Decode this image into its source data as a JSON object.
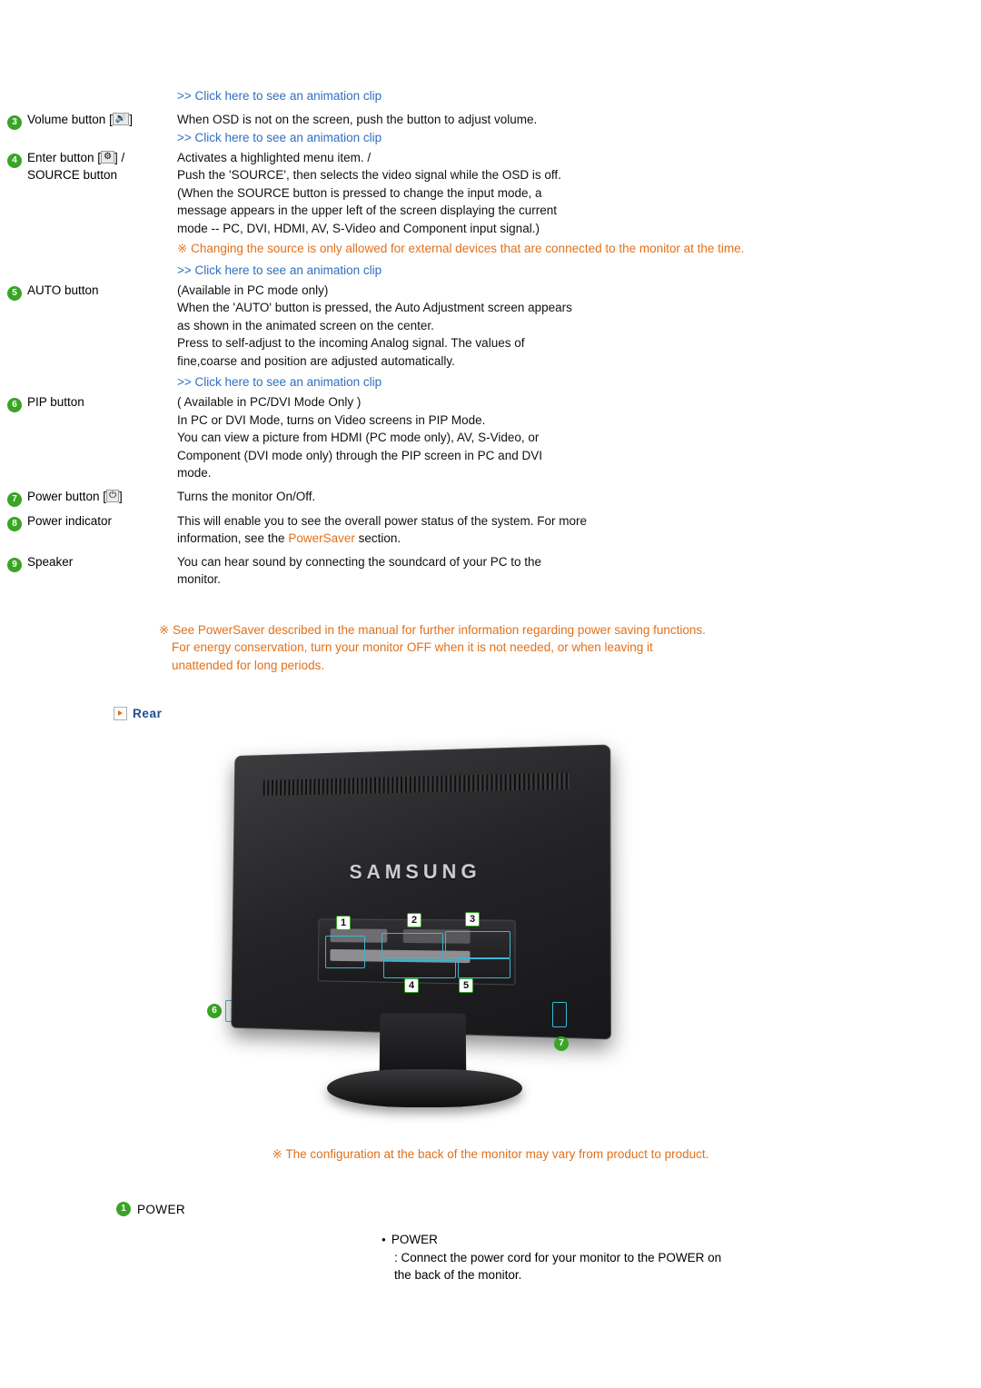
{
  "links": {
    "anim_clip": ">> Click here to see an animation clip"
  },
  "controls": [
    {
      "num": "3",
      "name": "Volume button [",
      "name_suffix": "]",
      "glyph": "volume-icon",
      "lines": [
        "When OSD is not on the screen, push the button to adjust volume."
      ],
      "pre_link": true,
      "post_link": true
    },
    {
      "num": "4",
      "name": "Enter button [",
      "name_suffix": "] /",
      "name_line2": "SOURCE button",
      "glyph": "enter-icon",
      "lines": [
        "Activates a highlighted menu item. /",
        "Push the 'SOURCE', then selects the video signal while the OSD is off.",
        "(When the SOURCE button is pressed to change the input mode, a",
        "message appears in the upper left of the screen displaying the current",
        "mode -- PC, DVI, HDMI, AV, S-Video and Component input signal.)"
      ],
      "note": "Changing the source is only allowed for external devices that are connected to the monitor at the time.",
      "note_mark": "※",
      "post_link": true
    },
    {
      "num": "5",
      "name": "AUTO button",
      "lines": [
        "(Available in PC mode only)",
        "When the 'AUTO' button is pressed, the Auto Adjustment screen appears",
        "as shown in the animated screen on the center.",
        "Press to self-adjust to the incoming Analog signal. The values of",
        "fine,coarse and position are adjusted automatically."
      ],
      "post_link": true
    },
    {
      "num": "6",
      "name": "PIP button",
      "lines": [
        "( Available in PC/DVI Mode Only )",
        "In PC or DVI Mode, turns on Video screens in PIP Mode.",
        "You can view a picture from HDMI (PC mode only), AV, S-Video, or",
        "Component (DVI mode only) through the PIP screen in PC and DVI",
        "mode."
      ]
    },
    {
      "num": "7",
      "name": "Power button [",
      "name_suffix": "]",
      "glyph": "power-icon",
      "lines": [
        "Turns the monitor On/Off."
      ]
    },
    {
      "num": "8",
      "name": "Power indicator",
      "lines": [
        "This will enable you to see the overall power status of the system. For more"
      ],
      "line_with_link_prefix": "information, see the ",
      "link_text": "PowerSaver",
      "line_with_link_suffix": " section."
    },
    {
      "num": "9",
      "name": "Speaker",
      "lines": [
        "You can hear sound by connecting the soundcard of your PC to the",
        "monitor."
      ]
    }
  ],
  "powersaver_note": {
    "mark": "※",
    "prefix": "See ",
    "link": "PowerSaver",
    "text": " described in the manual for further information regarding power saving functions. For energy conservation, turn your monitor OFF when it is not needed, or when leaving it unattended for long periods."
  },
  "rear_section": {
    "title": "Rear",
    "brand": "SAMSUNG",
    "callouts": [
      "1",
      "2",
      "3",
      "4",
      "5",
      "6",
      "7"
    ],
    "caption_mark": "※",
    "caption": "The configuration at the back of the monitor may vary from product to product."
  },
  "power_section": {
    "badge": "1",
    "heading": "POWER",
    "bullet_title": "POWER",
    "body_line1": ": Connect the power cord for your monitor to the POWER on",
    "body_line2": "the back of the monitor."
  }
}
